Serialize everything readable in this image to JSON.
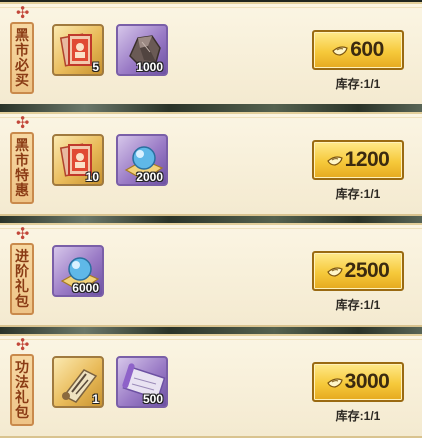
{
  "colors": {
    "panel": "#f8f0da",
    "gap": "#2a3328",
    "tag_text": "#8a3b14",
    "button_gold": "#f6c93b"
  },
  "rows": [
    {
      "tag": [
        "黑",
        "市",
        "必",
        "买"
      ],
      "items": [
        {
          "icon": "red-tome-icon",
          "style": "gold",
          "qty": "5"
        },
        {
          "icon": "ore-stone-icon",
          "style": "purple",
          "qty": "1000"
        }
      ],
      "price": "600",
      "stock_label": "库存:",
      "stock": "1/1"
    },
    {
      "tag": [
        "黑",
        "市",
        "特",
        "惠"
      ],
      "items": [
        {
          "icon": "red-tome-icon",
          "style": "gold",
          "qty": "10"
        },
        {
          "icon": "spirit-orb-icon",
          "style": "purple",
          "qty": "2000"
        }
      ],
      "price": "1200",
      "stock_label": "库存:",
      "stock": "1/1"
    },
    {
      "tag": [
        "进",
        "阶",
        "礼",
        "包"
      ],
      "items": [
        {
          "icon": "spirit-orb-icon",
          "style": "purple",
          "qty": "6000"
        }
      ],
      "price": "2500",
      "stock_label": "库存:",
      "stock": "1/1"
    },
    {
      "tag": [
        "功",
        "法",
        "礼",
        "包"
      ],
      "items": [
        {
          "icon": "scroll-icon",
          "style": "gold",
          "qty": "1"
        },
        {
          "icon": "purple-scroll-icon",
          "style": "purple",
          "qty": "500"
        }
      ],
      "price": "3000",
      "stock_label": "库存:",
      "stock": "1/1"
    }
  ]
}
